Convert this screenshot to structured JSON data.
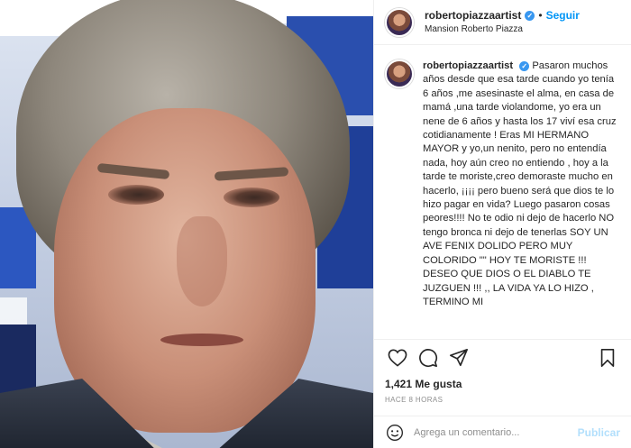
{
  "header": {
    "username": "robertopiazzaartist",
    "follow_label": "Seguir",
    "separator": "•",
    "location": "Mansion Roberto Piazza",
    "verified_glyph": "✓"
  },
  "caption": {
    "username": "robertopiazzaartist",
    "text": "Pasaron muchos años desde que esa tarde cuando yo tenía 6 años ,me asesinaste el alma, en casa de mamá ,una tarde violandome, yo era un nene de 6 años y hasta los 17 viví esa cruz cotidianamente ! Eras MI HERMANO MAYOR y yo,un nenito, pero no entendía nada, hoy aún creo no entiendo , hoy a la tarde te moriste,creo demoraste mucho en hacerlo, ¡¡¡¡ pero bueno será que dios te lo hizo pagar en vida? Luego pasaron cosas peores!!!! No te odio ni dejo de hacerlo NO tengo bronca ni dejo de tenerlas SOY UN AVE FENIX DOLIDO PERO MUY COLORIDO \"\" HOY TE MORISTE !!! DESEO QUE DIOS O EL DIABLO TE JUZGUEN !!! ,, LA VIDA YA LO HIZO , TERMINO MI"
  },
  "stats": {
    "likes": "1,421 Me gusta",
    "time_ago": "Hace 8 horas"
  },
  "comment": {
    "placeholder": "Agrega un comentario...",
    "publish_label": "Publicar"
  },
  "icons": {
    "like": "heart-icon",
    "comment": "comment-icon",
    "share": "share-icon",
    "save": "bookmark-icon",
    "emoji": "emoji-icon"
  },
  "colors": {
    "follow": "#0095f6",
    "verified": "#3897f0",
    "publish_disabled": "#b2dffc"
  }
}
